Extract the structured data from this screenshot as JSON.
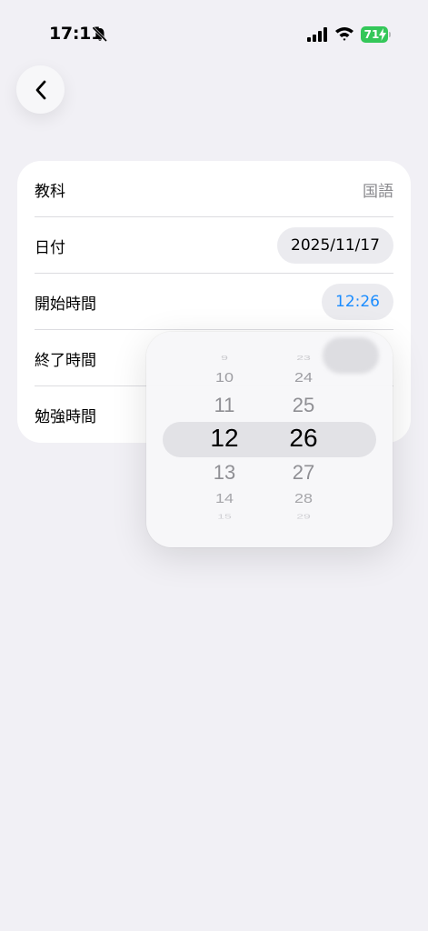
{
  "status_bar": {
    "time": "17:11",
    "battery_level": "71",
    "icons": [
      "bell-slash-icon",
      "cellular-signal-icon",
      "wifi-icon",
      "battery-charging-icon"
    ],
    "battery_color": "#34c759"
  },
  "nav": {
    "back_icon": "chevron-left-icon"
  },
  "form": {
    "subject": {
      "label": "教科",
      "value": "国語"
    },
    "date": {
      "label": "日付",
      "value": "2025/11/17"
    },
    "start_time": {
      "label": "開始時間",
      "value": "12:26"
    },
    "end_time": {
      "label": "終了時間"
    },
    "study_time": {
      "label": "勉強時間"
    }
  },
  "time_picker": {
    "hours": [
      "9",
      "10",
      "11",
      "12",
      "13",
      "14",
      "15"
    ],
    "minutes": [
      "23",
      "24",
      "25",
      "26",
      "27",
      "28",
      "29"
    ],
    "selected_hour": "12",
    "selected_minute": "26"
  },
  "colors": {
    "accent": "#1a8cff",
    "background": "#f1f0f5",
    "card": "#ffffff"
  }
}
